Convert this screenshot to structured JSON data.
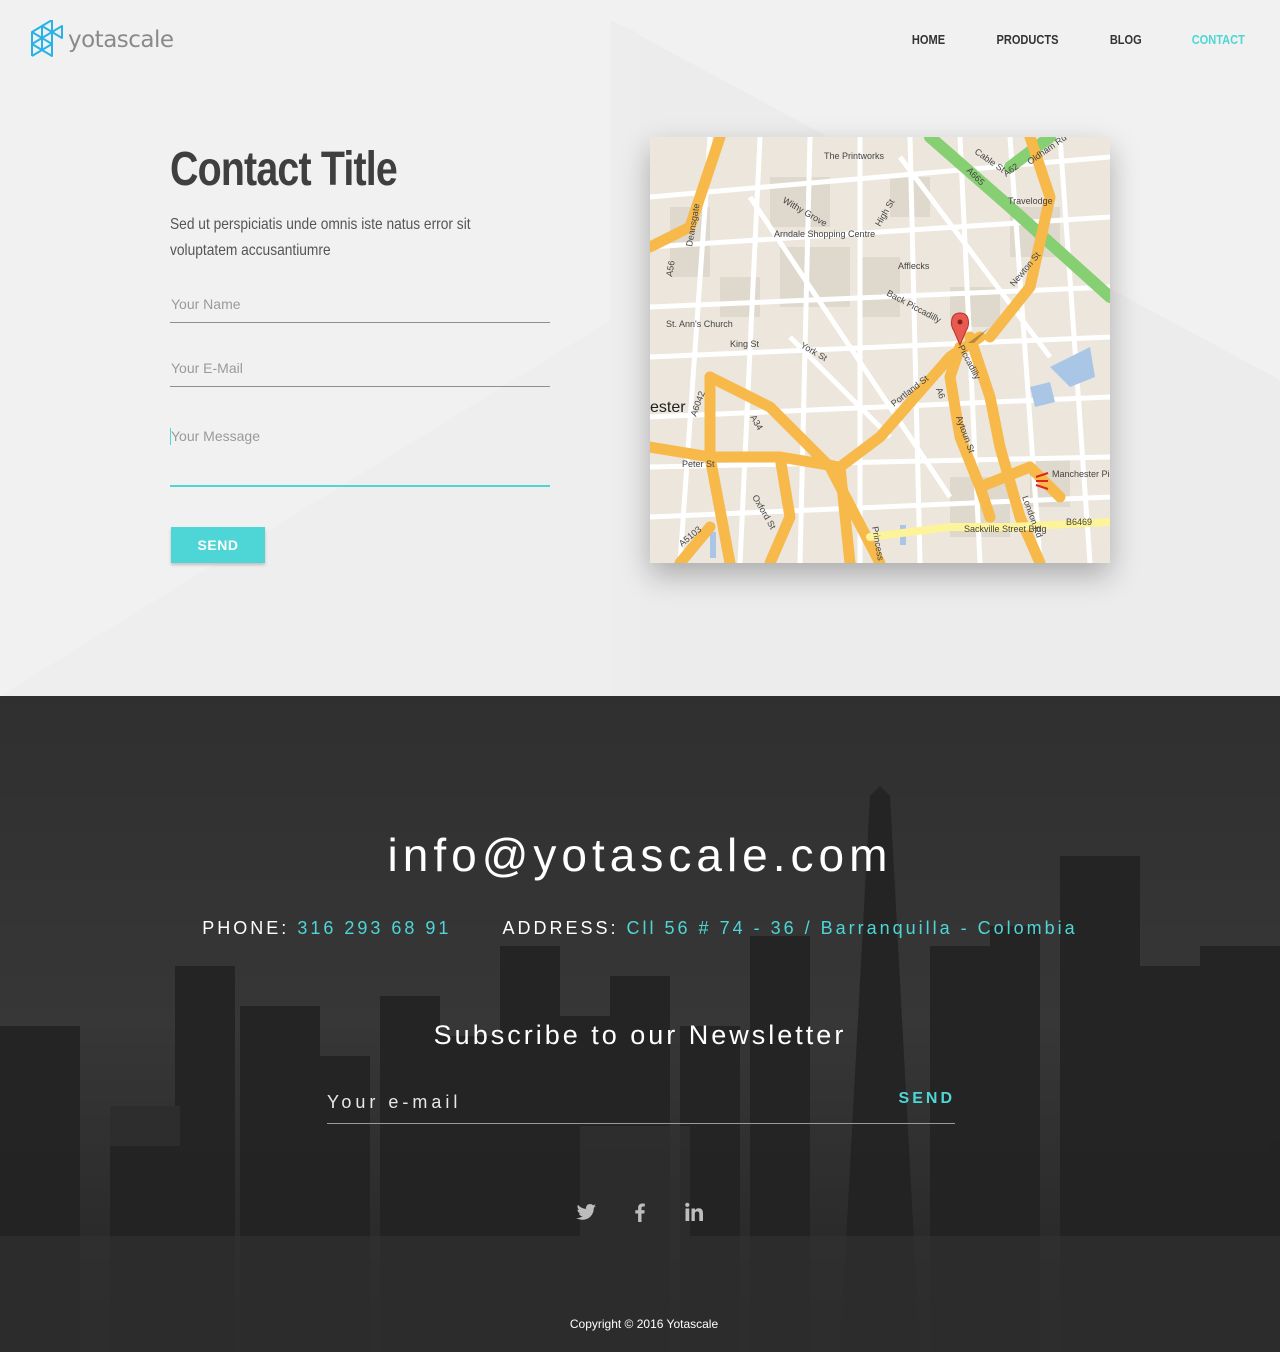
{
  "header": {
    "logo_text_a": "yota",
    "logo_text_b": "scale",
    "nav": [
      {
        "label": "HOME",
        "active": false
      },
      {
        "label": "PRODUCTS",
        "active": false
      },
      {
        "label": "BLOG",
        "active": false
      },
      {
        "label": "CONTACT",
        "active": true
      }
    ]
  },
  "contact": {
    "title": "Contact Title",
    "subtitle": "Sed ut perspiciatis unde omnis iste natus error sit voluptatem accusantiumre",
    "name_placeholder": "Your Name",
    "email_placeholder": "Your E-Mail",
    "message_placeholder": "Your Message",
    "send_label": "SEND"
  },
  "map": {
    "labels": {
      "printworks": "The Printworks",
      "withy": "Withy Grove",
      "arndale": "Arndale Shopping Centre",
      "travelodge": "Travelodge",
      "afflecks": "Afflecks",
      "back_piccadilly": "Back Piccadilly",
      "st_anns": "St. Ann's Church",
      "piccadilly": "Piccadilly",
      "portland": "Portland St",
      "manchester_piccadilly": "Manchester Piccadilly",
      "sackville": "Sackville Street Bldg",
      "ester": "ester",
      "king": "King St",
      "york": "York St",
      "peter": "Peter St",
      "oxford": "Oxford St",
      "a56": "A56",
      "a34": "A34",
      "a6": "A6",
      "a665": "A665",
      "a62": "A62",
      "a6042": "A6042",
      "a5103": "A5103",
      "b6469": "B6469",
      "newton": "Newton St",
      "london": "London Rd",
      "high": "High St",
      "deansgate": "Deansgate",
      "aytoun": "Aytoun St",
      "princess": "Princess St",
      "cable": "Cable St",
      "oldham": "Oldham Rd"
    }
  },
  "footer": {
    "email": "info@yotascale.com",
    "phone_label": "PHONE:",
    "phone_value": "316 293 68 91",
    "address_label": "ADDRESS:",
    "address_value": "Cll 56 # 74 - 36 / Barranquilla - Colombia",
    "newsletter_title": "Subscribe to our Newsletter",
    "newsletter_placeholder": "Your e-mail",
    "newsletter_send": "SEND",
    "copyright": "Copyright © 2016 Yotascale",
    "social_icons": [
      "twitter-icon",
      "facebook-icon",
      "linkedin-icon"
    ]
  },
  "colors": {
    "accent": "#4ed6d6",
    "logo_blue": "#27b3e6",
    "footer_bg": "#2e2e2e",
    "page_bg": "#f1f1f1"
  }
}
